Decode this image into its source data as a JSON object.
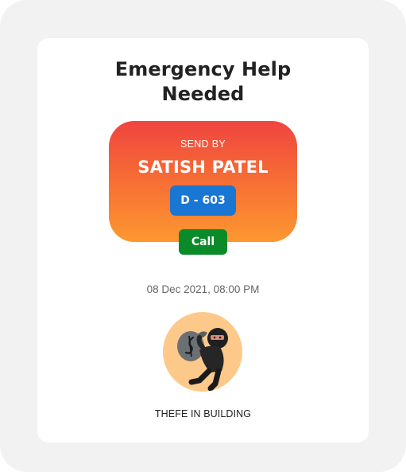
{
  "alert": {
    "title_line1": "Emergency Help",
    "title_line2": "Needed",
    "sent_by_label": "SEND BY",
    "sender_name": "SATISH PATEL",
    "unit": "D - 603",
    "call_label": "Call",
    "timestamp": "08 Dec 2021, 08:00 PM",
    "incident_icon": "thief-with-money-bag-icon",
    "incident_type": "THEFE IN BUILDING"
  },
  "colors": {
    "gradient_top": "#ef4540",
    "gradient_bottom": "#fd9830",
    "unit_badge": "#1976d2",
    "call_button": "#0b8a2a",
    "avatar_bg": "#fdc98a"
  }
}
